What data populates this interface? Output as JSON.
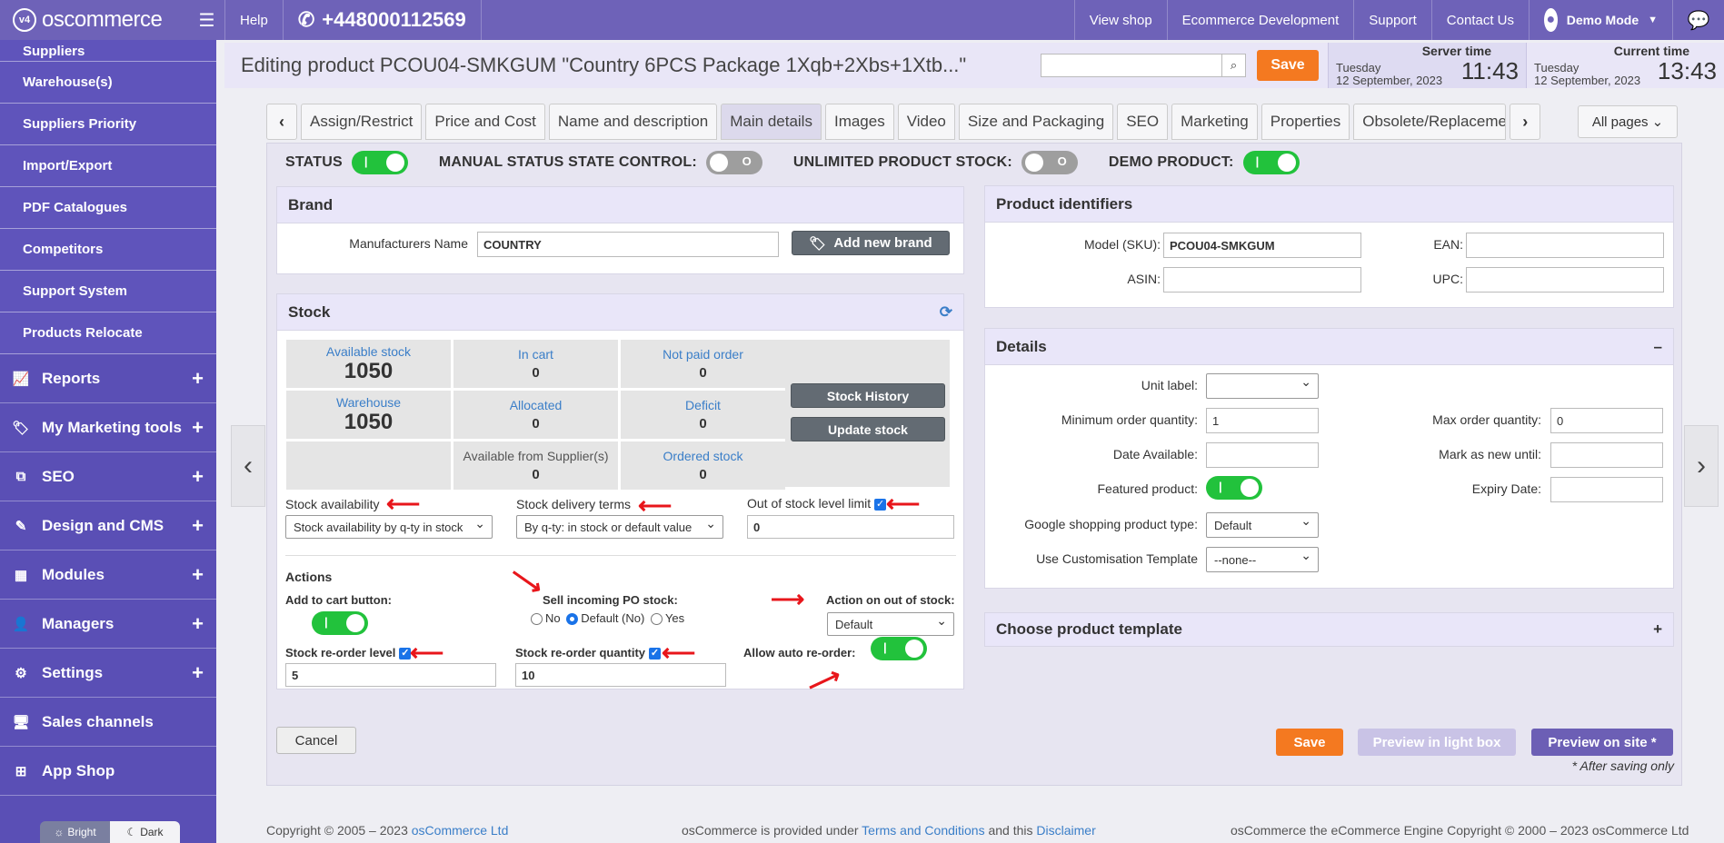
{
  "topbar": {
    "logo_text": "oscommerce",
    "logo_mark": "v4",
    "help": "Help",
    "phone": "+448000112569",
    "view_shop": "View shop",
    "ecommerce_dev": "Ecommerce Development",
    "support": "Support",
    "contact_us": "Contact Us",
    "user": "Demo Mode"
  },
  "sidebar": {
    "sub_items": [
      "Suppliers",
      "Warehouse(s)",
      "Suppliers Priority",
      "Import/Export",
      "PDF Catalogues",
      "Competitors",
      "Support System",
      "Products Relocate"
    ],
    "main_items": [
      {
        "label": "Reports",
        "icon": "chart-line-icon"
      },
      {
        "label": "My Marketing tools",
        "icon": "tag-icon"
      },
      {
        "label": "SEO",
        "icon": "sitemap-icon"
      },
      {
        "label": "Design and CMS",
        "icon": "brush-icon"
      },
      {
        "label": "Modules",
        "icon": "modules-icon"
      },
      {
        "label": "Managers",
        "icon": "user-icon"
      },
      {
        "label": "Settings",
        "icon": "gear-icon"
      },
      {
        "label": "Sales channels",
        "icon": "monitor-icon"
      },
      {
        "label": "App Shop",
        "icon": "app-shop-icon"
      }
    ],
    "theme_bright": "Bright",
    "theme_dark": "Dark"
  },
  "header": {
    "title": "Editing product PCOU04-SMKGUM \"Country 6PCS Package 1Xqb+2Xbs+1Xtb...\"",
    "save": "Save",
    "server_time_label": "Server time",
    "server_day": "Tuesday",
    "server_date": "12 September, 2023",
    "server_time": "11:43",
    "current_time_label": "Current time",
    "current_day": "Tuesday",
    "current_date": "12 September, 2023",
    "current_time": "13:43"
  },
  "tabs": [
    "Assign/Restrict",
    "Price and Cost",
    "Name and description",
    "Main details",
    "Images",
    "Video",
    "Size and Packaging",
    "SEO",
    "Marketing",
    "Properties",
    "Obsolete/Replacement"
  ],
  "active_tab": "Main details",
  "all_pages": "All pages",
  "status_row": {
    "status": "STATUS",
    "manual": "MANUAL STATUS STATE CONTROL:",
    "unlimited": "UNLIMITED PRODUCT STOCK:",
    "demo": "DEMO PRODUCT:",
    "off_mark": "O",
    "on_mark": "|"
  },
  "brand": {
    "title": "Brand",
    "manufacturer_label": "Manufacturers Name",
    "manufacturer_value": "COUNTRY",
    "add_new_brand": "Add new brand"
  },
  "stock": {
    "title": "Stock",
    "cells": [
      {
        "key": "Available stock",
        "value": "1050",
        "big": true
      },
      {
        "key": "In cart",
        "value": "0"
      },
      {
        "key": "Not paid order",
        "value": "0"
      },
      {
        "key": "Warehouse",
        "value": "1050",
        "big": true
      },
      {
        "key": "Allocated",
        "value": "0"
      },
      {
        "key": "Deficit",
        "value": "0"
      },
      {
        "key": "",
        "value": ""
      },
      {
        "key": "Available from Supplier(s)",
        "value": "0",
        "dark": true
      },
      {
        "key": "Ordered stock",
        "value": "0"
      }
    ],
    "stock_history": "Stock History",
    "update_stock": "Update stock",
    "availability_label": "Stock availability",
    "availability_value": "Stock availability by q-ty in stock",
    "delivery_label": "Stock delivery terms",
    "delivery_value": "By q-ty: in stock or default value",
    "out_of_stock_label": "Out of stock level limit",
    "out_of_stock_value": "0",
    "actions_label": "Actions",
    "add_to_cart_label": "Add to cart button:",
    "sell_incoming_label": "Sell incoming PO stock:",
    "radio_no": "No",
    "radio_default": "Default (No)",
    "radio_yes": "Yes",
    "action_out_label": "Action on out of stock:",
    "action_out_value": "Default",
    "reorder_level_label": "Stock re-order level",
    "reorder_level_value": "5",
    "reorder_qty_label": "Stock re-order quantity",
    "reorder_qty_value": "10",
    "auto_reorder_label": "Allow auto re-order:"
  },
  "identifiers": {
    "title": "Product identifiers",
    "model_label": "Model (SKU):",
    "model_value": "PCOU04-SMKGUM",
    "ean_label": "EAN:",
    "asin_label": "ASIN:",
    "upc_label": "UPC:"
  },
  "details": {
    "title": "Details",
    "collapse": "–",
    "unit_label": "Unit label:",
    "min_order_label": "Minimum order quantity:",
    "min_order_value": "1",
    "max_order_label": "Max order quantity:",
    "max_order_value": "0",
    "date_available_label": "Date Available:",
    "mark_new_label": "Mark as new until:",
    "featured_label": "Featured product:",
    "expiry_label": "Expiry Date:",
    "google_label": "Google shopping product type:",
    "google_value": "Default",
    "customisation_label": "Use Customisation Template",
    "customisation_value": "--none--"
  },
  "template": {
    "title": "Choose product template",
    "expand": "+"
  },
  "bottom": {
    "cancel": "Cancel",
    "save": "Save",
    "preview_lightbox": "Preview in light box",
    "preview_site": "Preview on site *",
    "after_saving": "* After saving only"
  },
  "footer": {
    "copyright": "Copyright © 2005 – 2023 ",
    "company": "osCommerce Ltd",
    "provided": "osCommerce is provided under ",
    "terms": "Terms and Conditions",
    "and_this": " and this ",
    "disclaimer": "Disclaimer",
    "engine": "osCommerce the eCommerce Engine Copyright © 2000 – 2023 osCommerce Ltd"
  },
  "colors": {
    "brand": "#6e62b8",
    "sidebar": "#5a4fb5",
    "accent_orange": "#f47920",
    "toggle_on": "#22c23c",
    "arrow_annotation": "#e8161b"
  }
}
